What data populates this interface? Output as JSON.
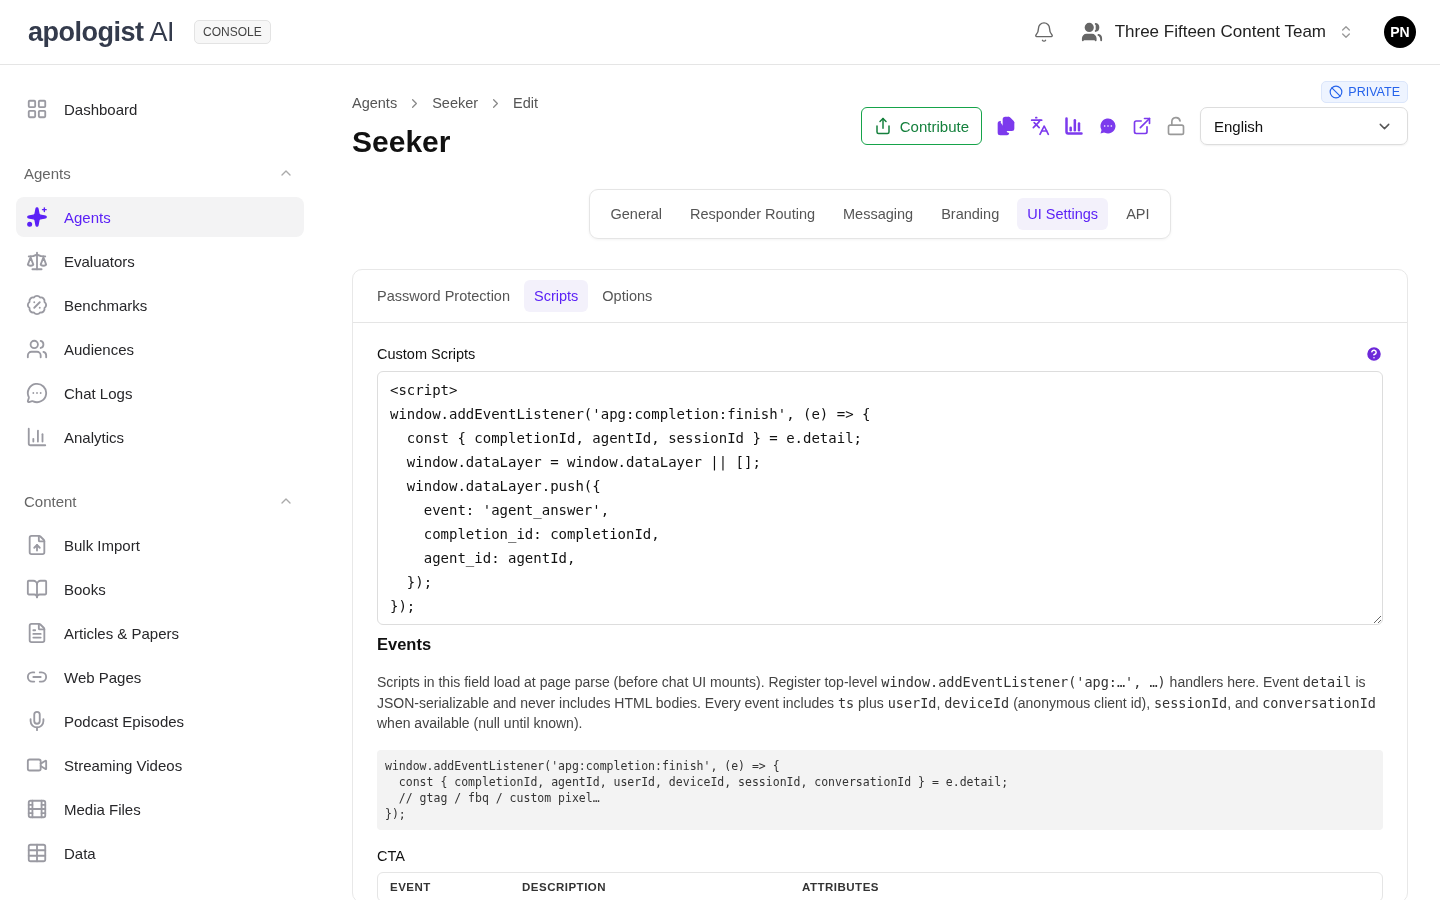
{
  "header": {
    "logo": "apologist",
    "logo_suffix": "AI",
    "badge": "CONSOLE",
    "team": "Three Fifteen Content Team",
    "avatar": "PN"
  },
  "sidebar": {
    "top": [
      {
        "label": "Dashboard",
        "selected": false
      }
    ],
    "groups": [
      {
        "title": "Agents",
        "expanded": true,
        "items": [
          {
            "label": "Agents",
            "selected": true
          },
          {
            "label": "Evaluators",
            "selected": false
          },
          {
            "label": "Benchmarks",
            "selected": false
          },
          {
            "label": "Audiences",
            "selected": false
          },
          {
            "label": "Chat Logs",
            "selected": false
          },
          {
            "label": "Analytics",
            "selected": false
          }
        ]
      },
      {
        "title": "Content",
        "expanded": true,
        "items": [
          {
            "label": "Bulk Import",
            "selected": false
          },
          {
            "label": "Books",
            "selected": false
          },
          {
            "label": "Articles & Papers",
            "selected": false
          },
          {
            "label": "Web Pages",
            "selected": false
          },
          {
            "label": "Podcast Episodes",
            "selected": false
          },
          {
            "label": "Streaming Videos",
            "selected": false
          },
          {
            "label": "Media Files",
            "selected": false
          },
          {
            "label": "Data",
            "selected": false
          }
        ]
      }
    ]
  },
  "breadcrumbs": [
    "Agents",
    "Seeker",
    "Edit"
  ],
  "title": "Seeker",
  "visibility": "PRIVATE",
  "contribute_button": "Contribute",
  "locked": false,
  "language": "English",
  "tabs": [
    {
      "label": "General",
      "selected": false
    },
    {
      "label": "Responder Routing",
      "selected": false
    },
    {
      "label": "Messaging",
      "selected": false
    },
    {
      "label": "Branding",
      "selected": false
    },
    {
      "label": "UI Settings",
      "selected": true
    },
    {
      "label": "API",
      "selected": false
    }
  ],
  "subtabs": [
    {
      "label": "Password Protection",
      "selected": false
    },
    {
      "label": "Scripts",
      "selected": true
    },
    {
      "label": "Options",
      "selected": false
    }
  ],
  "custom_scripts": {
    "label": "Custom Scripts",
    "value": "<script>\nwindow.addEventListener('apg:completion:finish', (e) => {\n  const { completionId, agentId, sessionId } = e.detail;\n  window.dataLayer = window.dataLayer || [];\n  window.dataLayer.push({\n    event: 'agent_answer',\n    completion_id: completionId,\n    agent_id: agentId,\n  });\n});"
  },
  "events": {
    "heading": "Events",
    "description": [
      {
        "text": "Scripts in this field load at page parse (before chat UI mounts). Register top-level ",
        "code": false
      },
      {
        "text": "window.addEventListener('apg:…', …)",
        "code": true
      },
      {
        "text": " handlers here. Event ",
        "code": false
      },
      {
        "text": "detail",
        "code": true
      },
      {
        "text": " is JSON-serializable and never includes HTML bodies. Every event includes ",
        "code": false
      },
      {
        "text": "ts",
        "code": true
      },
      {
        "text": " plus ",
        "code": false
      },
      {
        "text": "userId",
        "code": true
      },
      {
        "text": ", ",
        "code": false
      },
      {
        "text": "deviceId",
        "code": true
      },
      {
        "text": " (anonymous client id), ",
        "code": false
      },
      {
        "text": "sessionId",
        "code": true
      },
      {
        "text": ", and ",
        "code": false
      },
      {
        "text": "conversationId",
        "code": true
      },
      {
        "text": " when available (null until known).",
        "code": false
      }
    ],
    "example": "window.addEventListener('apg:completion:finish', (e) => {\n  const { completionId, agentId, userId, deviceId, sessionId, conversationId } = e.detail;\n  // gtag / fbq / custom pixel…\n});"
  },
  "cta": {
    "heading": "CTA",
    "columns": [
      "EVENT",
      "DESCRIPTION",
      "ATTRIBUTES"
    ]
  }
}
